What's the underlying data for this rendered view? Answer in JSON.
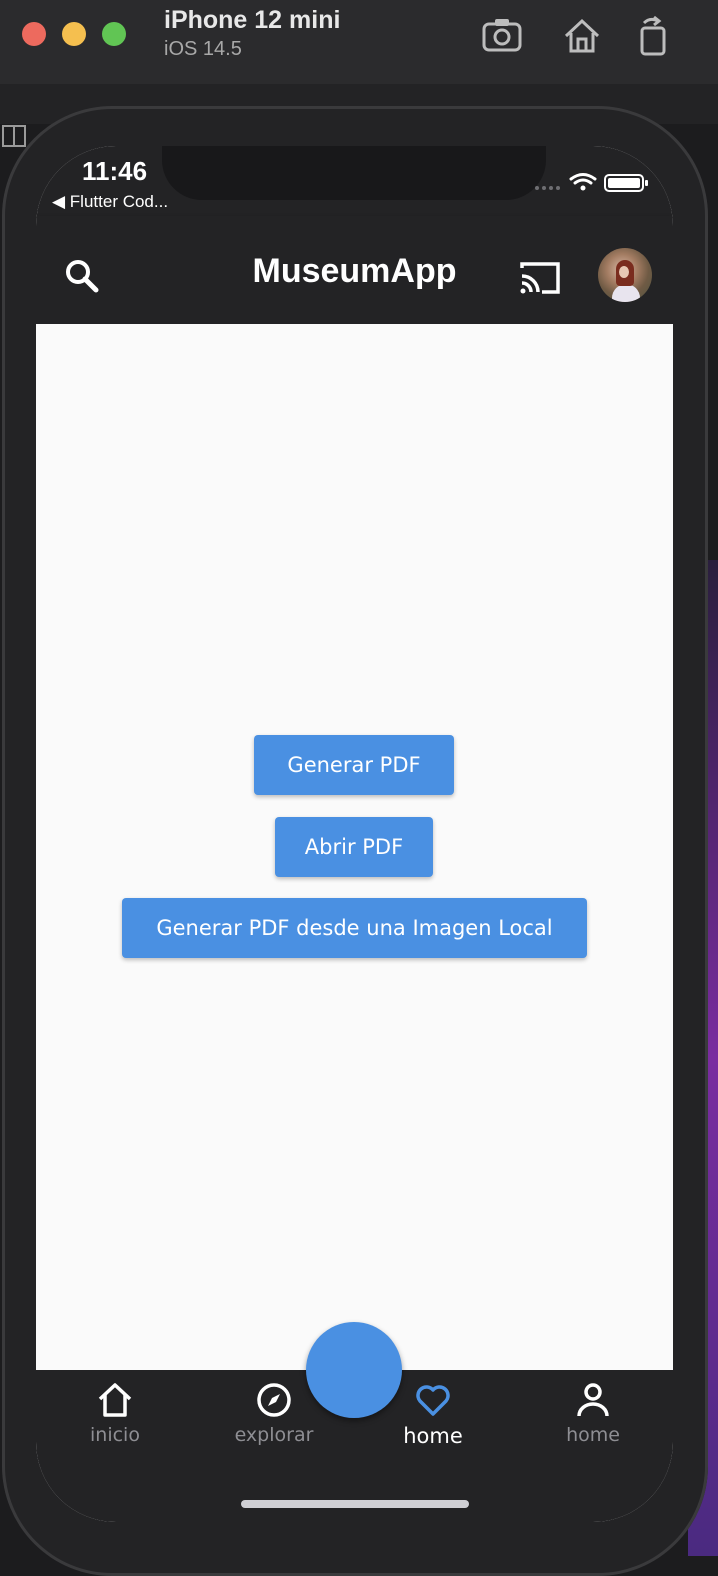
{
  "window": {
    "title": "iPhone 12 mini",
    "subtitle": "iOS 14.5"
  },
  "status_bar": {
    "time": "11:46",
    "back_link": "◀ Flutter Cod..."
  },
  "app_bar": {
    "title": "MuseumApp",
    "icons": [
      "search-icon",
      "cast-icon",
      "avatar"
    ]
  },
  "main": {
    "buttons": {
      "generate_pdf": "Generar PDF",
      "open_pdf": "Abrir PDF",
      "generate_from_image": "Generar PDF desde una Imagen Local"
    }
  },
  "bottom_nav": {
    "items": [
      {
        "label": "inicio",
        "icon": "home-icon",
        "active": false
      },
      {
        "label": "explorar",
        "icon": "compass-icon",
        "active": false
      },
      {
        "label": "home",
        "icon": "heart-icon",
        "active": true
      },
      {
        "label": "home",
        "icon": "person-icon",
        "active": false
      }
    ]
  },
  "colors": {
    "accent": "#4a90e2",
    "bar_background": "#232325",
    "content_background": "#fafafa"
  }
}
